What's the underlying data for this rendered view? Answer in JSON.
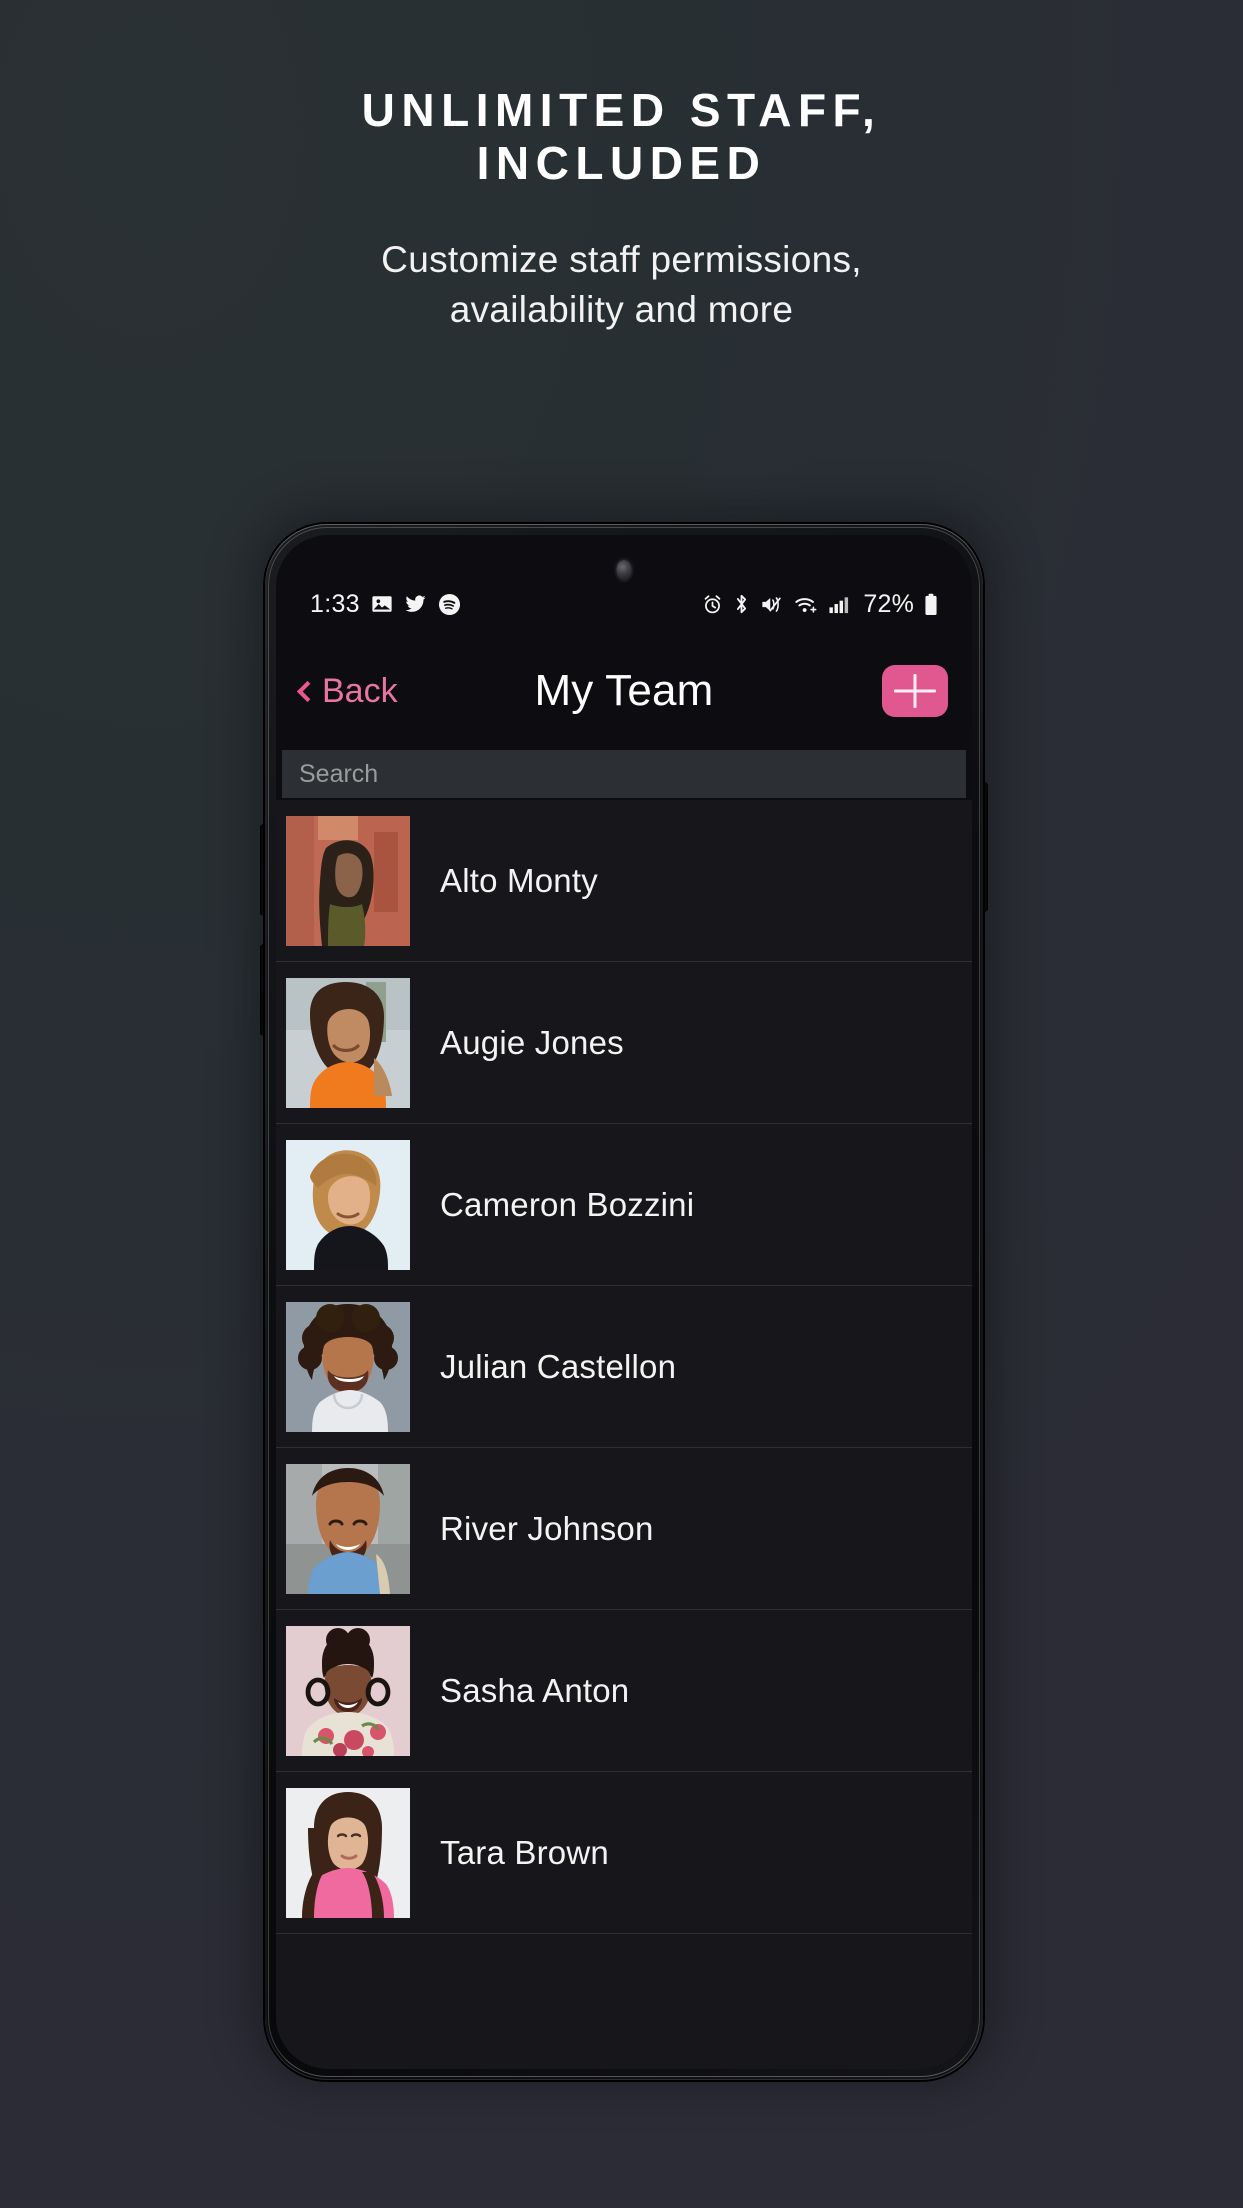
{
  "promo": {
    "title_line1": "UNLIMITED STAFF,",
    "title_line2": "INCLUDED",
    "subtitle_line1": "Customize staff permissions,",
    "subtitle_line2": "availability and more"
  },
  "colors": {
    "background": "#272E31",
    "background_end": "#2B2C36",
    "accent_pink": "#E0588F",
    "accent_pink_light": "#E8759E",
    "screen_bg": "#0D0D11",
    "list_bg": "#17171B",
    "search_bg": "#2C2F33",
    "divider": "#2E2E33",
    "text_primary": "#F3F3F3"
  },
  "statusbar": {
    "time": "1:33",
    "battery_percent": "72%",
    "left_icons": [
      "photo-icon",
      "twitter-icon",
      "spotify-icon"
    ],
    "right_icons": [
      "alarm-icon",
      "bluetooth-icon",
      "mute-vibrate-icon",
      "wifi-icon",
      "cellular-signal-icon",
      "battery-icon"
    ]
  },
  "nav": {
    "back_label": "Back",
    "title": "My Team",
    "add_label": "+"
  },
  "search": {
    "value": "",
    "placeholder": "Search"
  },
  "team": {
    "members": [
      {
        "name": "Alto Monty",
        "avatar": "woman in olive jacket by red building"
      },
      {
        "name": "Augie Jones",
        "avatar": "smiling woman in orange top"
      },
      {
        "name": "Cameron Bozzini",
        "avatar": "short-haired woman in black"
      },
      {
        "name": "Julian Castellon",
        "avatar": "smiling man with curly hair"
      },
      {
        "name": "River Johnson",
        "avatar": "smiling man in blue shirt"
      },
      {
        "name": "Sasha Anton",
        "avatar": "woman in floral top with hoop earrings"
      },
      {
        "name": "Tara Brown",
        "avatar": "woman in pink sweater"
      }
    ]
  }
}
